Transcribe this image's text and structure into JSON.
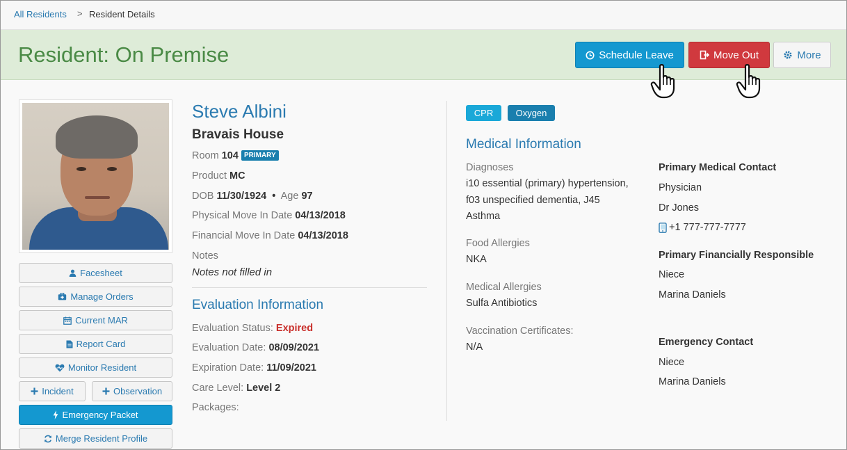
{
  "breadcrumb": {
    "root": "All Residents",
    "separator": ">",
    "current": "Resident Details"
  },
  "header": {
    "title": "Resident: On Premise",
    "schedule_leave": "Schedule Leave",
    "move_out": "Move Out",
    "more": "More"
  },
  "sidebar": {
    "facesheet": "Facesheet",
    "manage_orders": "Manage Orders",
    "current_mar": "Current MAR",
    "report_card": "Report Card",
    "monitor_resident": "Monitor Resident",
    "incident": "Incident",
    "observation": "Observation",
    "emergency_packet": "Emergency Packet",
    "merge_profile": "Merge Resident Profile"
  },
  "resident": {
    "name": "Steve Albini",
    "house": "Bravais House",
    "room_label": "Room",
    "room": "104",
    "room_badge": "PRIMARY",
    "product_label": "Product",
    "product": "MC",
    "dob_label": "DOB",
    "dob": "11/30/1924",
    "age_label": "Age",
    "age": "97",
    "physical_move_in_label": "Physical Move In Date",
    "physical_move_in": "04/13/2018",
    "financial_move_in_label": "Financial Move In Date",
    "financial_move_in": "04/13/2018",
    "notes_label": "Notes",
    "notes": "Notes not filled in"
  },
  "evaluation": {
    "heading": "Evaluation Information",
    "status_label": "Evaluation Status:",
    "status": "Expired",
    "date_label": "Evaluation Date:",
    "date": "08/09/2021",
    "expiration_label": "Expiration Date:",
    "expiration": "11/09/2021",
    "care_level_label": "Care Level:",
    "care_level": "Level 2",
    "packages_label": "Packages:"
  },
  "tags": {
    "cpr": "CPR",
    "oxygen": "Oxygen",
    "cpr_color": "#1aa8d8",
    "oxygen_color": "#1a7fae"
  },
  "medical": {
    "heading": "Medical Information",
    "diagnoses_label": "Diagnoses",
    "diagnoses_line1": "i10 essential (primary) hypertension,",
    "diagnoses_line2": "f03 unspecified dementia, J45",
    "diagnoses_line3": "Asthma",
    "food_allergies_label": "Food Allergies",
    "food_allergies": "NKA",
    "medical_allergies_label": "Medical Allergies",
    "medical_allergies": "Sulfa Antibiotics",
    "vaccination_label": "Vaccination Certificates:",
    "vaccination": "N/A"
  },
  "contacts": {
    "primary_medical_heading": "Primary Medical Contact",
    "primary_medical_role": "Physician",
    "primary_medical_name": "Dr Jones",
    "primary_medical_phone": "+1 777-777-7777",
    "financial_heading": "Primary Financially Responsible",
    "financial_role": "Niece",
    "financial_name": "Marina Daniels",
    "emergency_heading": "Emergency Contact",
    "emergency_role": "Niece",
    "emergency_name": "Marina Daniels"
  }
}
